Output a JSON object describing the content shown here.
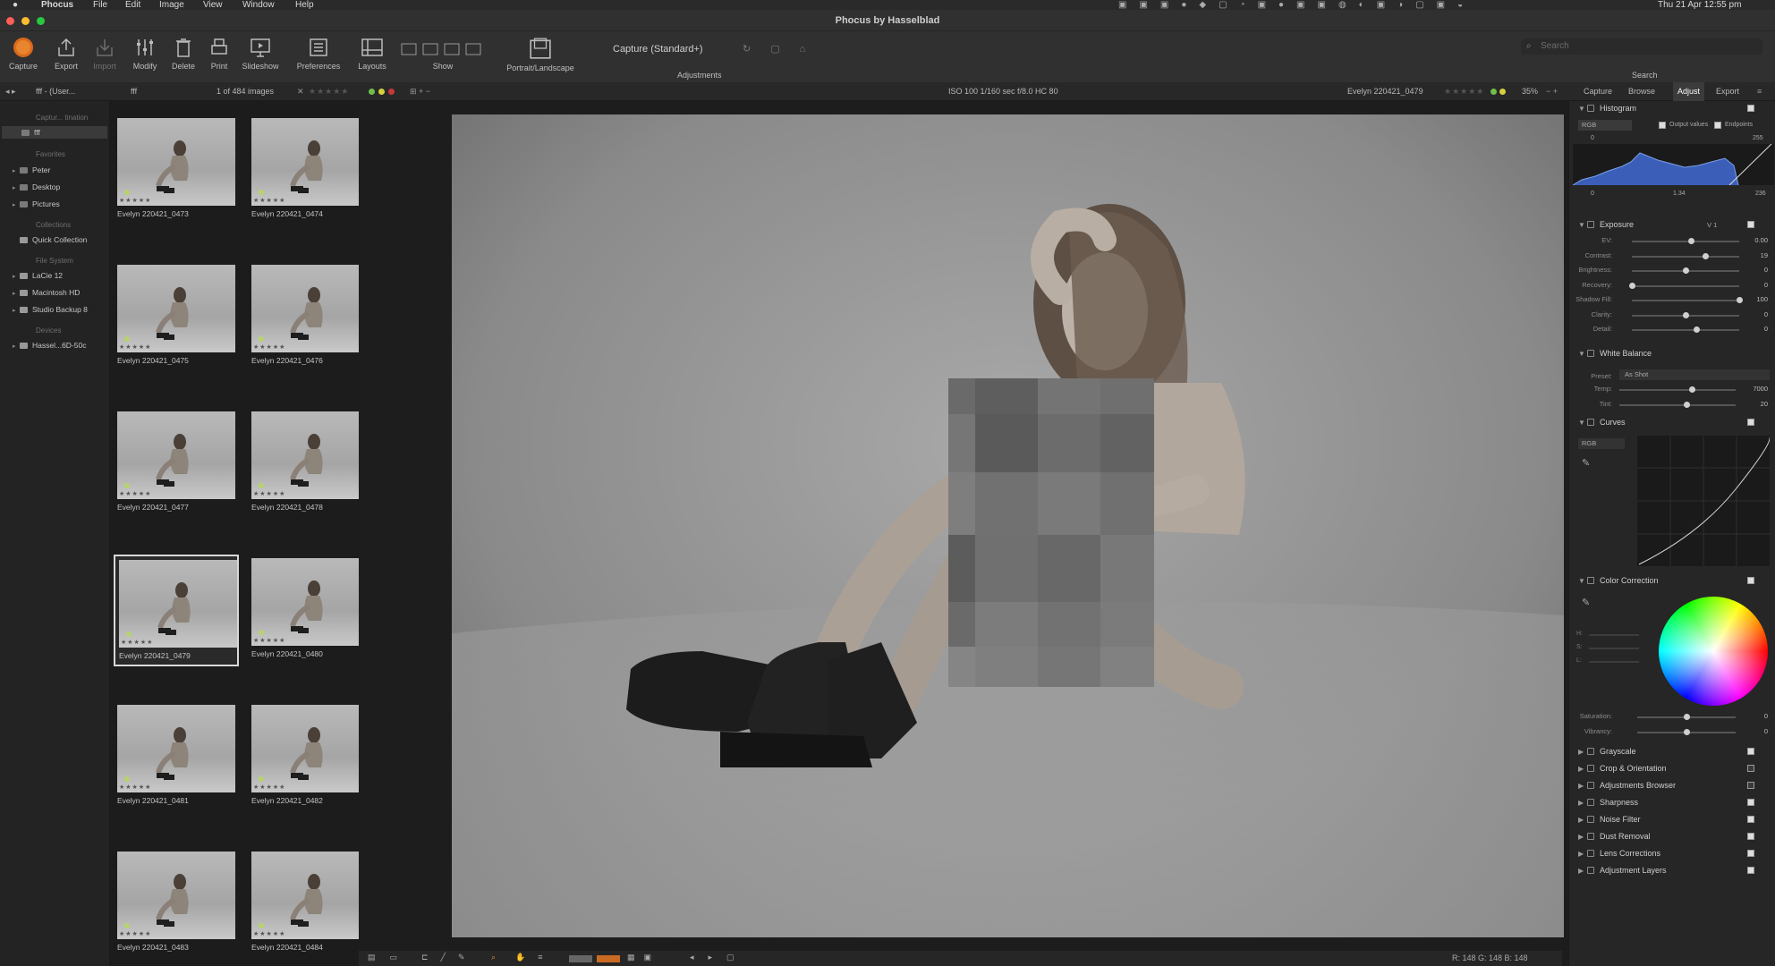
{
  "menubar": {
    "apple": "",
    "app": "Phocus",
    "items": [
      "File",
      "Edit",
      "Image",
      "View",
      "Window",
      "Help"
    ],
    "clock": "Thu 21 Apr  12:55 pm"
  },
  "window": {
    "title": "Phocus by Hasselblad"
  },
  "toolbar": {
    "buttons": [
      "Capture",
      "Export",
      "Import",
      "Modify",
      "Delete",
      "Print",
      "Slideshow",
      "Preferences",
      "Layouts",
      "Show",
      "Portrait/Landscape",
      "Adjustments"
    ],
    "preset": "Capture (Standard+)",
    "search_placeholder": "Search",
    "search_label": "Search"
  },
  "subbar": {
    "path": "fff - (User...",
    "folder": "fff",
    "count": "1 of 484 images",
    "exif": "ISO 100   1/160 sec   f/8.0   HC 80",
    "filename": "Evelyn 220421_0479",
    "zoom": "35%",
    "tabs": [
      "Capture",
      "Browse",
      "Adjust",
      "Export"
    ],
    "active_tab": "Adjust"
  },
  "sidebar": {
    "sections": [
      {
        "header": "Captur... tination",
        "items": [
          "fff"
        ]
      },
      {
        "header": "Favorites",
        "items": [
          "Peter",
          "Desktop",
          "Pictures"
        ]
      },
      {
        "header": "Collections",
        "items": [
          "Quick Collection"
        ]
      },
      {
        "header": "File System",
        "items": [
          "LaCie 12",
          "Macintosh HD",
          "Studio Backup 8"
        ]
      },
      {
        "header": "Devices",
        "items": [
          "Hassel...6D-50c"
        ]
      }
    ]
  },
  "thumbnails": [
    "Evelyn 220421_0473",
    "Evelyn 220421_0474",
    "Evelyn 220421_0475",
    "Evelyn 220421_0476",
    "Evelyn 220421_0477",
    "Evelyn 220421_0478",
    "Evelyn 220421_0479",
    "Evelyn 220421_0480",
    "Evelyn 220421_0481",
    "Evelyn 220421_0482",
    "Evelyn 220421_0483",
    "Evelyn 220421_0484"
  ],
  "selected_thumbnail": "Evelyn 220421_0479",
  "histogram": {
    "title": "Histogram",
    "channel": "RGB",
    "output_values": "Output values",
    "endpoints": "Endpoints",
    "top_left": "0",
    "top_right": "255",
    "bottom_left": "0",
    "bottom_mid": "1.34",
    "bottom_right": "236"
  },
  "exposure": {
    "title": "Exposure",
    "version": "V 1",
    "sliders": [
      {
        "label": "EV:",
        "value": "0.00",
        "pos": 0.55
      },
      {
        "label": "Contrast:",
        "value": "19",
        "pos": 0.68
      },
      {
        "label": "Brightness:",
        "value": "0",
        "pos": 0.5
      },
      {
        "label": "Recovery:",
        "value": "0",
        "pos": 0.0
      },
      {
        "label": "Shadow Fill:",
        "value": "100",
        "pos": 1.0
      },
      {
        "label": "Clarity:",
        "value": "0",
        "pos": 0.5
      },
      {
        "label": "Detail:",
        "value": "0",
        "pos": 0.6
      }
    ]
  },
  "white_balance": {
    "title": "White Balance",
    "preset_label": "Preset:",
    "preset": "As Shot",
    "sliders": [
      {
        "label": "Temp:",
        "value": "7000",
        "pos": 0.62
      },
      {
        "label": "Tint:",
        "value": "20",
        "pos": 0.58
      }
    ]
  },
  "curves": {
    "title": "Curves",
    "channel": "RGB"
  },
  "color_correction": {
    "title": "Color Correction",
    "hsl": [
      "H:",
      "S:",
      "L:"
    ],
    "sliders": [
      {
        "label": "Saturation:",
        "value": "0",
        "pos": 0.5
      },
      {
        "label": "Vibrancy:",
        "value": "0",
        "pos": 0.5
      }
    ]
  },
  "collapsed_sections": [
    "Grayscale",
    "Crop & Orientation",
    "Adjustments Browser",
    "Sharpness",
    "Noise Filter",
    "Dust Removal",
    "Lens Corrections",
    "Adjustment Layers"
  ],
  "statusbar": {
    "rgb": "R: 148  G: 148  B: 148"
  }
}
